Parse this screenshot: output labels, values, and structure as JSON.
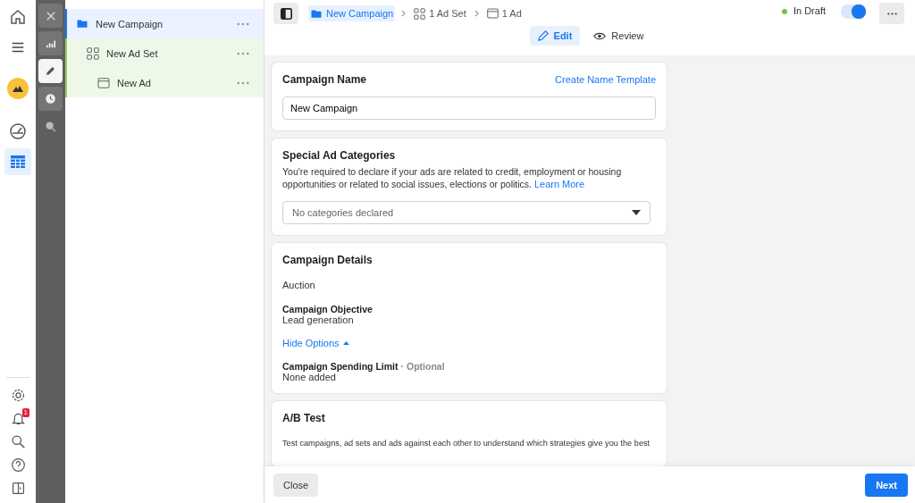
{
  "nav": {
    "top": [
      {
        "selected": false
      },
      {
        "selected": false
      },
      {
        "selected": false
      },
      {
        "selected": false
      },
      {
        "selected": true
      }
    ],
    "badge": "1"
  },
  "tools": [
    {
      "selected": false
    },
    {
      "selected": false
    },
    {
      "selected": true
    },
    {
      "selected": false
    },
    {
      "selected": false
    }
  ],
  "tree": [
    {
      "label": "New Campaign",
      "selected": true,
      "children": [
        {
          "label": "New Ad Set",
          "selected": false,
          "children": [
            {
              "label": "New Ad",
              "selected": false
            }
          ]
        }
      ]
    }
  ],
  "breadcrumb": [
    {
      "label": "New Campaign",
      "selected": true
    },
    {
      "label": "1 Ad Set",
      "selected": false
    },
    {
      "label": "1 Ad",
      "selected": false
    }
  ],
  "status": {
    "label": "In Draft",
    "color": "#7ac143",
    "on": true
  },
  "tabs": [
    {
      "label": "Edit",
      "selected": true
    },
    {
      "label": "Review",
      "selected": false
    }
  ],
  "campaign_name": {
    "title": "Campaign Name",
    "link": "Create Name Template",
    "value": "New Campaign"
  },
  "special": {
    "title": "Special Ad Categories",
    "text": "You're required to declare if your ads are related to credit, employment or housing opportunities or related to social issues, elections or politics.",
    "link": "Learn More",
    "select": "No categories declared"
  },
  "details": {
    "title": "Campaign Details",
    "buying": "Auction",
    "objective_label": "Campaign Objective",
    "objective": "Lead generation",
    "toggle": "Hide Options",
    "limit_label": "Campaign Spending Limit",
    "limit_note": "· Optional",
    "limit": "None added"
  },
  "ab": {
    "title": "A/B Test",
    "text": "Test campaigns, ad sets and ads against each other to understand which strategies give you the best"
  },
  "footer": {
    "close": "Close",
    "next": "Next"
  }
}
